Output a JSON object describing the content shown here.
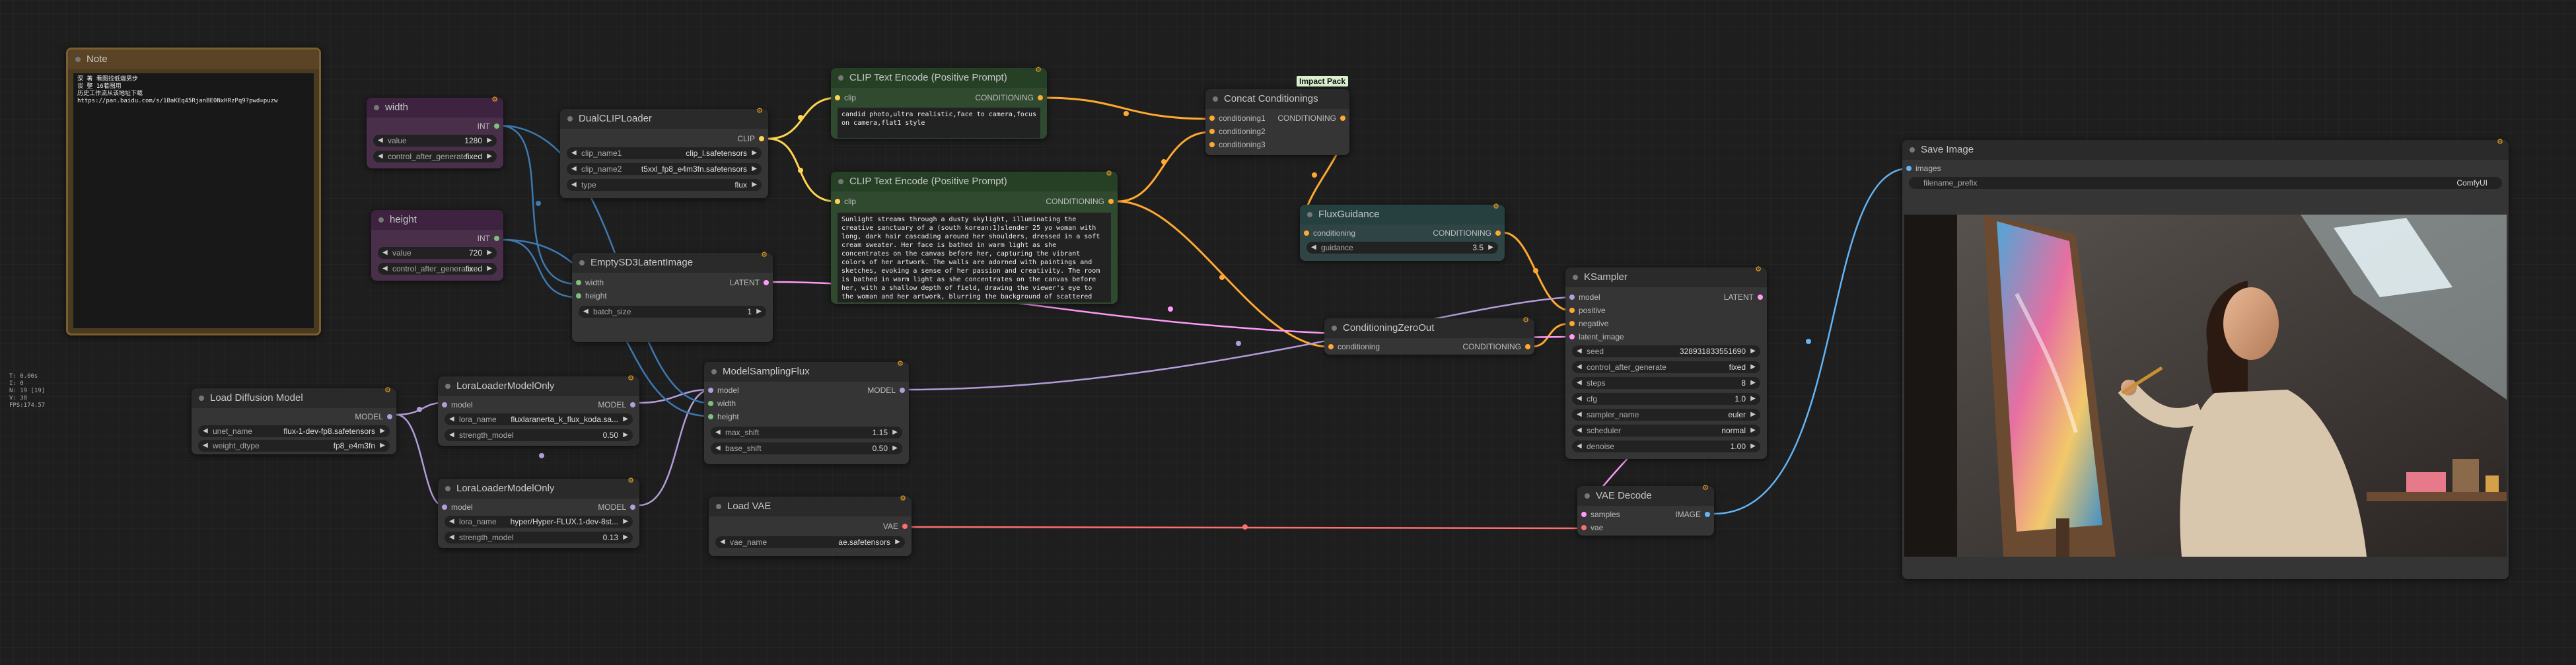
{
  "colors": {
    "model": "#b39ddb",
    "clip": "#ffd54f",
    "conditioning": "#ffa931",
    "latent": "#ff9cf9",
    "vae": "#ff6e6e",
    "image": "#64b5f6",
    "int": "#7fbf7f"
  },
  "info_overlay": {
    "lines": [
      "T: 0.00s",
      "I: 0",
      "N: 19 [19]",
      "V: 38",
      "FPS:174.57"
    ]
  },
  "note": {
    "title": "Note",
    "text": [
      "深 著 看图找低端男步",
      "谈 整 16着图用",
      "历史工作流从该地址下载",
      "https://pan.baidu.com/s/1BaKEq45RjanBE0NxHRzPq9?pwd=puzw"
    ]
  },
  "width_node": {
    "title": "width",
    "out": "INT",
    "w1_label": "value",
    "w1_value": "1280",
    "w2_label": "control_after_generate",
    "w2_value": "fixed"
  },
  "height_node": {
    "title": "height",
    "out": "INT",
    "w1_label": "value",
    "w1_value": "720",
    "w2_label": "control_after_generate",
    "w2_value": "fixed"
  },
  "dualclip": {
    "title": "DualCLIPLoader",
    "out": "CLIP",
    "clip_name1_label": "clip_name1",
    "clip_name1": "clip_l.safetensors",
    "clip_name2_label": "clip_name2",
    "clip_name2": "t5xxl_fp8_e4m3fn.safetensors",
    "type_label": "type",
    "type": "flux"
  },
  "clip_pos1": {
    "title": "CLIP Text Encode (Positive Prompt)",
    "in": "clip",
    "out": "CONDITIONING",
    "text": "candid photo,ultra realistic,face to camera,focus on camera,flat1 style"
  },
  "clip_pos2": {
    "title": "CLIP Text Encode (Positive Prompt)",
    "in": "clip",
    "out": "CONDITIONING",
    "text": "Sunlight streams through a dusty skylight, illuminating the creative sanctuary of a (south korean:1)slender 25 yo woman with long, dark hair cascading around her shoulders, dressed in a soft cream sweater. Her face is bathed in warm light as she concentrates on the canvas before her, capturing the vibrant colors of her artwork. The walls are adorned with paintings and sketches, evoking a sense of her passion and creativity. The room is bathed in warm light as she concentrates on the canvas before her, with a shallow depth of field, drawing the viewer's eye to the woman and her artwork, blurring the background of scattered paintbrushes and canvases into a dreamy, evocative haze."
  },
  "concat": {
    "title": "Concat Conditionings",
    "group": "Impact Pack",
    "in1": "conditioning1",
    "in2": "conditioning2",
    "in3": "conditioning3",
    "out": "CONDITIONING"
  },
  "empty_latent": {
    "title": "EmptySD3LatentImage",
    "in1": "width",
    "in2": "height",
    "out": "LATENT",
    "w_label": "batch_size",
    "w_value": "1"
  },
  "flux_guidance": {
    "title": "FluxGuidance",
    "in": "conditioning",
    "out": "CONDITIONING",
    "w_label": "guidance",
    "w_value": "3.5"
  },
  "zero_out": {
    "title": "ConditioningZeroOut",
    "in": "conditioning",
    "out": "CONDITIONING"
  },
  "ksampler": {
    "title": "KSampler",
    "in1": "model",
    "in2": "positive",
    "in3": "negative",
    "in4": "latent_image",
    "out": "LATENT",
    "widgets": [
      {
        "label": "seed",
        "value": "328931833551690"
      },
      {
        "label": "control_after_generate",
        "value": "fixed"
      },
      {
        "label": "steps",
        "value": "8"
      },
      {
        "label": "cfg",
        "value": "1.0"
      },
      {
        "label": "sampler_name",
        "value": "euler"
      },
      {
        "label": "scheduler",
        "value": "normal"
      },
      {
        "label": "denoise",
        "value": "1.00"
      }
    ]
  },
  "vae_decode": {
    "title": "VAE Decode",
    "in1": "samples",
    "in2": "vae",
    "out": "IMAGE"
  },
  "save_image": {
    "title": "Save Image",
    "in": "images",
    "w_label": "filename_prefix",
    "w_value": "ComfyUI"
  },
  "load_diffusion": {
    "title": "Load Diffusion Model",
    "out": "MODEL",
    "w1_label": "unet_name",
    "w1_value": "flux-1-dev-fp8.safetensors",
    "w2_label": "weight_dtype",
    "w2_value": "fp8_e4m3fn"
  },
  "lora1": {
    "title": "LoraLoaderModelOnly",
    "in": "model",
    "out": "MODEL",
    "w1_label": "lora_name",
    "w1_value": "fluxlaranerta_k_flux_koda.sa...",
    "w2_label": "strength_model",
    "w2_value": "0.50"
  },
  "lora2": {
    "title": "LoraLoaderModelOnly",
    "in": "model",
    "out": "MODEL",
    "w1_label": "lora_name",
    "w1_value": "hyper/Hyper-FLUX.1-dev-8st...",
    "w2_label": "strength_model",
    "w2_value": "0.13"
  },
  "model_sampling": {
    "title": "ModelSamplingFlux",
    "in1": "model",
    "in2": "width",
    "in3": "height",
    "out": "MODEL",
    "w1_label": "max_shift",
    "w1_value": "1.15",
    "w2_label": "base_shift",
    "w2_value": "0.50"
  },
  "load_vae": {
    "title": "Load VAE",
    "out": "VAE",
    "w_label": "vae_name",
    "w_value": "ae.safetensors"
  }
}
